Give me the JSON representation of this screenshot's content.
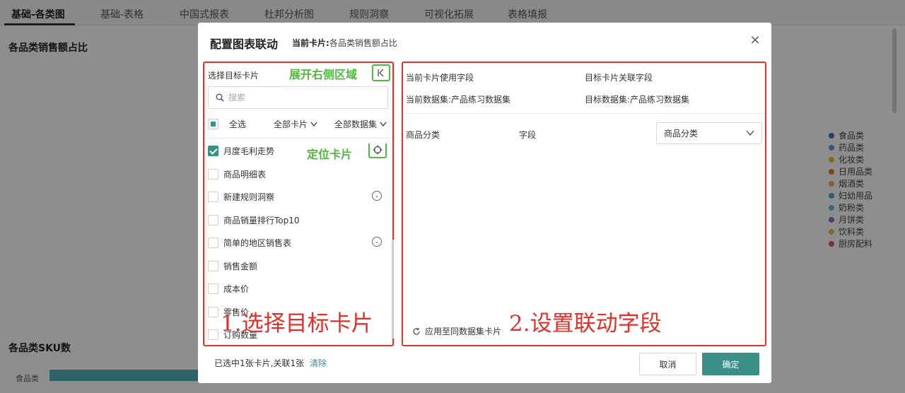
{
  "tabs": [
    {
      "label": "基础-各类图",
      "active": true
    },
    {
      "label": "基础-表格"
    },
    {
      "label": "中国式报表"
    },
    {
      "label": "杜邦分析图"
    },
    {
      "label": "规则洞察"
    },
    {
      "label": "可视化拓展"
    },
    {
      "label": "表格填报"
    }
  ],
  "dashboard": {
    "card1_title": "各品类销售额占比",
    "card2_title": "各品类SKU数",
    "legend": [
      {
        "label": "食品类",
        "color": "#3d6cc4"
      },
      {
        "label": "药品类",
        "color": "#5f8fd6"
      },
      {
        "label": "化妆类",
        "color": "#e3b422"
      },
      {
        "label": "日用品类",
        "color": "#d8752b"
      },
      {
        "label": "烟酒类",
        "color": "#dca45a"
      },
      {
        "label": "妇幼用品",
        "color": "#4aa3c7"
      },
      {
        "label": "奶粉类",
        "color": "#5fb0d8"
      },
      {
        "label": "月饼类",
        "color": "#7f6fc4"
      },
      {
        "label": "饮料类",
        "color": "#d8b55a"
      },
      {
        "label": "厨房配料",
        "color": "#d0585a"
      }
    ],
    "bar_category": "食品类",
    "bar_color": "#4fa9b2"
  },
  "modal": {
    "title": "配置图表联动",
    "current_card_label": "当前卡片:",
    "current_card_value": "各品类销售额占比",
    "close_icon": "×",
    "left": {
      "heading": "选择目标卡片",
      "annot_expand": "展开右侧区域",
      "search_placeholder": "搜索",
      "select_all": "全选",
      "dropdown_cards": "全部卡片",
      "dropdown_datasets": "全部数据集",
      "annot_locate": "定位卡片",
      "items": [
        {
          "label": "月度毛利走势",
          "checked": true
        },
        {
          "label": "商品明细表"
        },
        {
          "label": "新建规则洞察",
          "expandable": true
        },
        {
          "label": "商品销量排行Top10"
        },
        {
          "label": "简单的地区销售表",
          "expandable": true
        },
        {
          "label": "销售金额"
        },
        {
          "label": "成本价"
        },
        {
          "label": "零售价"
        },
        {
          "label": "订购数量"
        }
      ],
      "big_annot": "1.选择目标卡片"
    },
    "right": {
      "current_field_header": "当前卡片使用字段",
      "target_field_header": "目标卡片关联字段",
      "current_dataset": "当前数据集:产品练习数据集",
      "target_dataset": "目标数据集:产品练习数据集",
      "row_field": "商品分类",
      "row_type": "字段",
      "row_select": "商品分类",
      "apply_label": "应用至同数据集卡片",
      "big_annot": "2.设置联动字段"
    },
    "footer": {
      "status": "已选中1张卡片,关联1张",
      "clear": "清除",
      "cancel": "取消",
      "ok": "确定"
    },
    "accent_color": "#3a8f87",
    "annot_red": "#e1312b",
    "annot_green": "#52b83f"
  }
}
